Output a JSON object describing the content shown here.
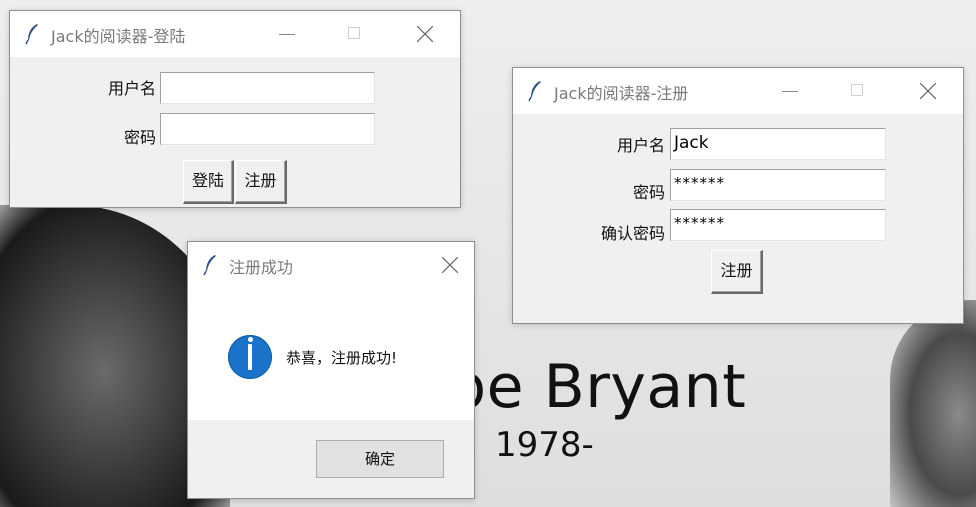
{
  "wallpaper": {
    "line1": "be Bryant",
    "line2": "1978-"
  },
  "login_window": {
    "title": "Jack的阅读器-登陆",
    "username_label": "用户名",
    "username_value": "",
    "password_label": "密码",
    "password_value": "",
    "login_button": "登陆",
    "register_button": "注册"
  },
  "register_window": {
    "title": "Jack的阅读器-注册",
    "username_label": "用户名",
    "username_value": "Jack",
    "password_label": "密码",
    "password_value": "******",
    "confirm_label": "确认密码",
    "confirm_value": "******",
    "register_button": "注册"
  },
  "message_box": {
    "title": "注册成功",
    "icon": "info-icon",
    "message": "恭喜，注册成功!",
    "ok_button": "确定"
  },
  "colors": {
    "info_icon": "#1a73c8",
    "window_bg": "#f0f0f0",
    "titlebar_bg": "#ffffff"
  }
}
